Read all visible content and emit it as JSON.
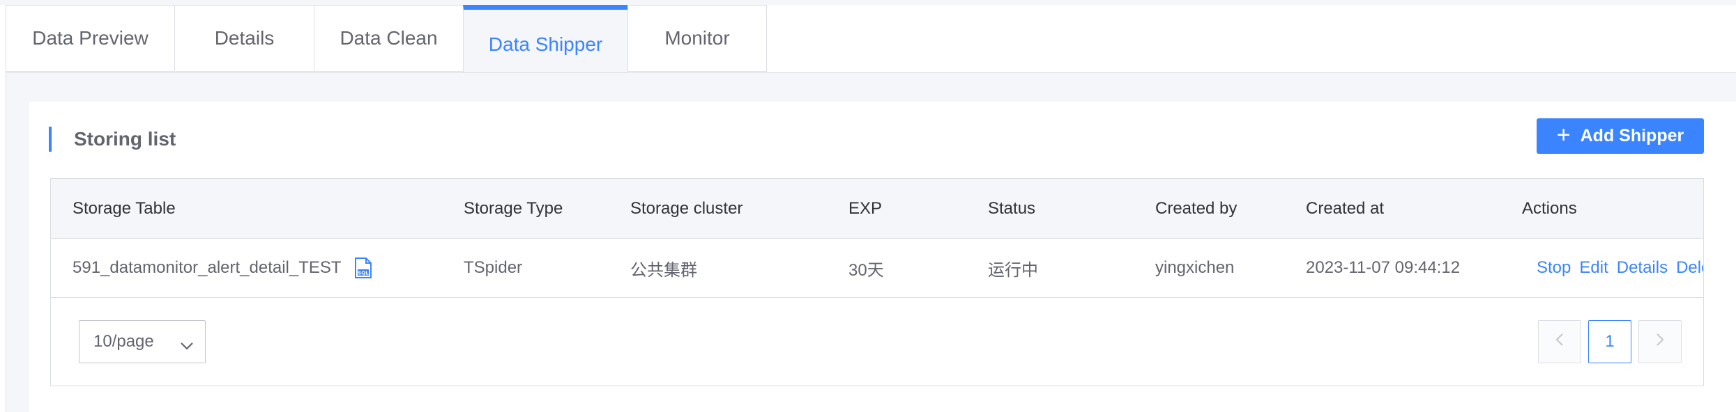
{
  "tabs": [
    {
      "label": "Data Preview",
      "active": false
    },
    {
      "label": "Details",
      "active": false
    },
    {
      "label": "Data Clean",
      "active": false
    },
    {
      "label": "Data Shipper",
      "active": true
    },
    {
      "label": "Monitor",
      "active": false
    }
  ],
  "section": {
    "title": "Storing list",
    "add_button": "Add Shipper"
  },
  "table": {
    "columns": [
      "Storage Table",
      "Storage Type",
      "Storage cluster",
      "EXP",
      "Status",
      "Created by",
      "Created at",
      "Actions"
    ],
    "rows": [
      {
        "storage_table": "591_datamonitor_alert_detail_TEST",
        "storage_type": "TSpider",
        "storage_cluster": "公共集群",
        "exp": "30天",
        "status": "运行中",
        "created_by": "yingxichen",
        "created_at": "2023-11-07 09:44:12",
        "actions": [
          "Stop",
          "Edit",
          "Details",
          "Delete"
        ]
      }
    ]
  },
  "pagination": {
    "page_size": "10/page",
    "current_page": "1"
  },
  "icons": {
    "add": "plus-icon",
    "sql_file": "sql-file-icon",
    "dropdown": "chevron-down-icon",
    "prev": "chevron-left-icon",
    "next": "chevron-right-icon"
  },
  "colors": {
    "accent": "#3a84ff",
    "status_running": "#2dcb56",
    "panel_bg": "#f5f6fa"
  }
}
